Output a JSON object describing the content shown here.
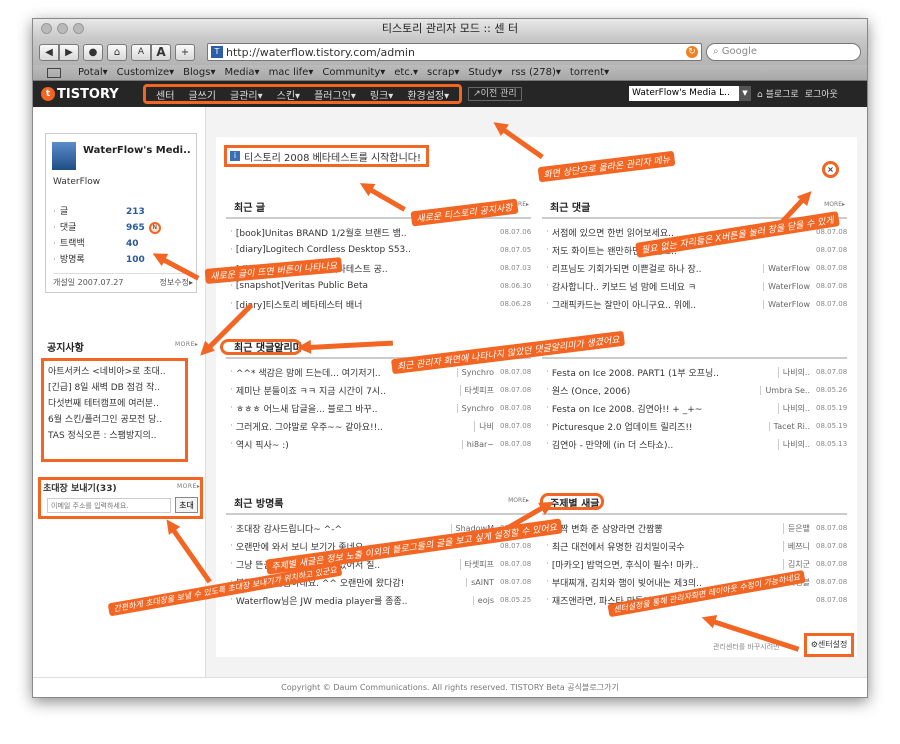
{
  "window": {
    "title": "티스토리 관리자 모드 :: 센 터"
  },
  "toolbar": {
    "nav": [
      "◀",
      "▶"
    ],
    "stop": "●",
    "home": "⌂",
    "font_small": "A",
    "font_large": "A",
    "add": "+",
    "url": "http://waterflow.tistory.com/admin",
    "search_placeholder": "Google"
  },
  "bookmarks": [
    "Potal▾",
    "Customize▾",
    "Blogs▾",
    "Media▾",
    "mac life▾",
    "Community▾",
    "etc.▾",
    "scrap▾",
    "Study▾",
    "rss (278)▾",
    "torrent▾"
  ],
  "tistory": {
    "logo": "TISTORY",
    "menu": [
      "센터",
      "글쓰기",
      "글관리▾",
      "스킨▾",
      "플러그인▾",
      "링크▾",
      "환경설정▾"
    ],
    "prev_manage": "↗이전 관리",
    "blog_select": "WaterFlow's Media L..",
    "to_blog": "⌂ 블로그로",
    "logout": "로그아웃"
  },
  "sidebar": {
    "blog_name": "WaterFlow's Medi..",
    "owner": "WaterFlow",
    "stats": [
      {
        "label": "글",
        "value": "213"
      },
      {
        "label": "댓글",
        "value": "965"
      },
      {
        "label": "트랙백",
        "value": "40"
      },
      {
        "label": "방명록",
        "value": "100"
      }
    ],
    "opened": "개설일 2007.07.27",
    "edit": "정보수정▸",
    "notice_title": "공지사항",
    "more": "MORE▸",
    "notices": [
      "아트서커스 <네비아>로 초대..",
      "[긴급] 8일 새벽 DB 점검 작..",
      "다섯번째 테터캠프에 여러분..",
      "6월 스킨/플러그인 공모전 당..",
      "TAS 정식오픈 : 스팸방지의.."
    ],
    "invite_title": "초대장 보내기(33)",
    "invite_placeholder": "이메일 주소를 입력하세요.",
    "invite_button": "초대"
  },
  "main": {
    "beta_notice": "티스토리 2008 베타테스트를 시작합니다!",
    "close": "×",
    "more": "MORE▸",
    "recent_posts": {
      "title": "최근 글",
      "items": [
        {
          "t": "[book]Unitas BRAND 1/2월호 브랜드 뱀..",
          "d": "08.07.06"
        },
        {
          "t": "[diary]Logitech Cordless Desktop S53..",
          "d": "08.07.05"
        },
        {
          "t": "[diary]드디어 티스토리 베타테스트 공..",
          "d": "08.07.03"
        },
        {
          "t": "[snapshot]Veritas Public Beta",
          "d": "08.06.30"
        },
        {
          "t": "[diary]티스토리 베타테스터 배너",
          "d": "08.06.28"
        }
      ]
    },
    "recent_comments": {
      "title": "최근 댓글",
      "items": [
        {
          "t": "서점에 있으면 한번 읽어보세요..",
          "w": "",
          "d": "08.07.08"
        },
        {
          "t": "저도 화이트는 왠만하면 잘 안쓰..",
          "w": "",
          "d": "08.07.08"
        },
        {
          "t": "리프님도 기회가되면 이쁜걸로 하나 장..",
          "w": "WaterFlow",
          "d": "08.07.08"
        },
        {
          "t": "감사합니다.. 키보드 넘 맘에 드네요 ㅋ",
          "w": "WaterFlow",
          "d": "08.07.08"
        },
        {
          "t": "그래픽카드는 잘만이 아니구요.. 위에..",
          "w": "WaterFlow",
          "d": "08.07.08"
        }
      ]
    },
    "comment_alerts": {
      "title": "최근 댓글알리미",
      "items": [
        {
          "t": "^^* 색감은 맘에 드는데... 여기저기..",
          "w": "Synchro",
          "d": "08.07.08"
        },
        {
          "t": "제미난 분들이죠 ㅋㅋ 지금 시간이 7시..",
          "w": "타셋피프",
          "d": "08.07.08"
        },
        {
          "t": "ㅎㅎㅎ 어느새 답글을... 블로그 바꾸..",
          "w": "Synchro",
          "d": "08.07.08"
        },
        {
          "t": "그러게요. 그야말로 우주~~ 같아요!!..",
          "w": "나비",
          "d": "08.07.08"
        },
        {
          "t": "역시 픽사~ :)",
          "w": "hi8ar~",
          "d": "08.07.08"
        }
      ]
    },
    "recent_trackbacks": {
      "title": "",
      "items": [
        {
          "t": "Festa on Ice 2008. PART1 (1부 오프닝..",
          "w": "나비의..",
          "d": "08.07.08"
        },
        {
          "t": "원스 (Once, 2006)",
          "w": "Umbra Se..",
          "d": "08.05.26"
        },
        {
          "t": "Festa on Ice 2008. 김연아!! + _+~",
          "w": "나비의..",
          "d": "08.05.19"
        },
        {
          "t": "Picturesque 2.0 업데이트 릴리즈!!",
          "w": "Tacet Ri..",
          "d": "08.05.19"
        },
        {
          "t": "김연아 - 만약에 (in 더 스타쇼)..",
          "w": "나비의..",
          "d": "08.05.13"
        }
      ]
    },
    "guestbook": {
      "title": "최근 방명록",
      "items": [
        {
          "t": "초대장 감사드립니다~ ^-^",
          "w": "ShadowM",
          "d": "08.07.08"
        },
        {
          "t": "오랜만에 와서 보니 보기가 좋네요..",
          "w": "",
          "d": "08.07.08"
        },
        {
          "t": "그냥 뜬금없이 궁금한 점이 있어서 질..",
          "w": "타셋피프",
          "d": "08.07.08"
        },
        {
          "t": "블로그 참 깔끔하네요. ^^ 오랜만에 왔다감!",
          "w": "sAINT",
          "d": "08.07.08"
        },
        {
          "t": "Waterflow님은 JW media player를 종종..",
          "w": "eojs",
          "d": "08.05.25"
        }
      ]
    },
    "category_posts": {
      "title": "주제별 새글",
      "items": [
        {
          "t": "살짝 변화 준 삼양라면 간짬뽕",
          "w": "듣은뱉",
          "d": "08.07.08"
        },
        {
          "t": "최근 대전에서 유명한 김치밀이국수",
          "w": "베쯔니",
          "d": "08.07.08"
        },
        {
          "t": "[마카오] 밥먹으면, 후식이 필수! 마카..",
          "w": "김치군",
          "d": "08.07.08"
        },
        {
          "t": "부대찌개, 김치와 햄이 빚어내는 제3의..",
          "w": "닥터김블",
          "d": "08.07.08"
        },
        {
          "t": "재즈앤라면, 파스타 만들기 그리고..",
          "w": "",
          "d": "08.07.08"
        }
      ]
    },
    "mgr_note": "관리센터를 바꾸시려면",
    "center_settings": "⚙센터설정"
  },
  "footer": "Copyright © Daum Communications. All rights reserved. TISTORY Beta 공식블로그가기",
  "annotations": {
    "menu": "화면 상단으로 올라온 관리자 메뉴",
    "beta": "새로운 티스토리 공지사항",
    "close": "필요 없는 자리들은 X버튼을 눌러 창을 닫을 수 있게",
    "stats": "새로운 글이 뜨면 버튼이 나타나요",
    "alerts": "최근 관리자 화면에 나타나지 않았던 댓글알리미가 생겼어요",
    "category": "주제별 새글은 정보 노출 이외의 블로그들의 글을 보고 싶게 설정할 수 있어요",
    "invite": "간편하게 초대장을 보낼 수 있도록 초대장 보내기가 위치하고 있군요",
    "settings": "센터설정을 통해 관리자화면 레이아웃 수정이 가능하네요"
  },
  "colors": {
    "accent": "#f26522",
    "bar": "#262626",
    "link": "#2a5a98"
  }
}
